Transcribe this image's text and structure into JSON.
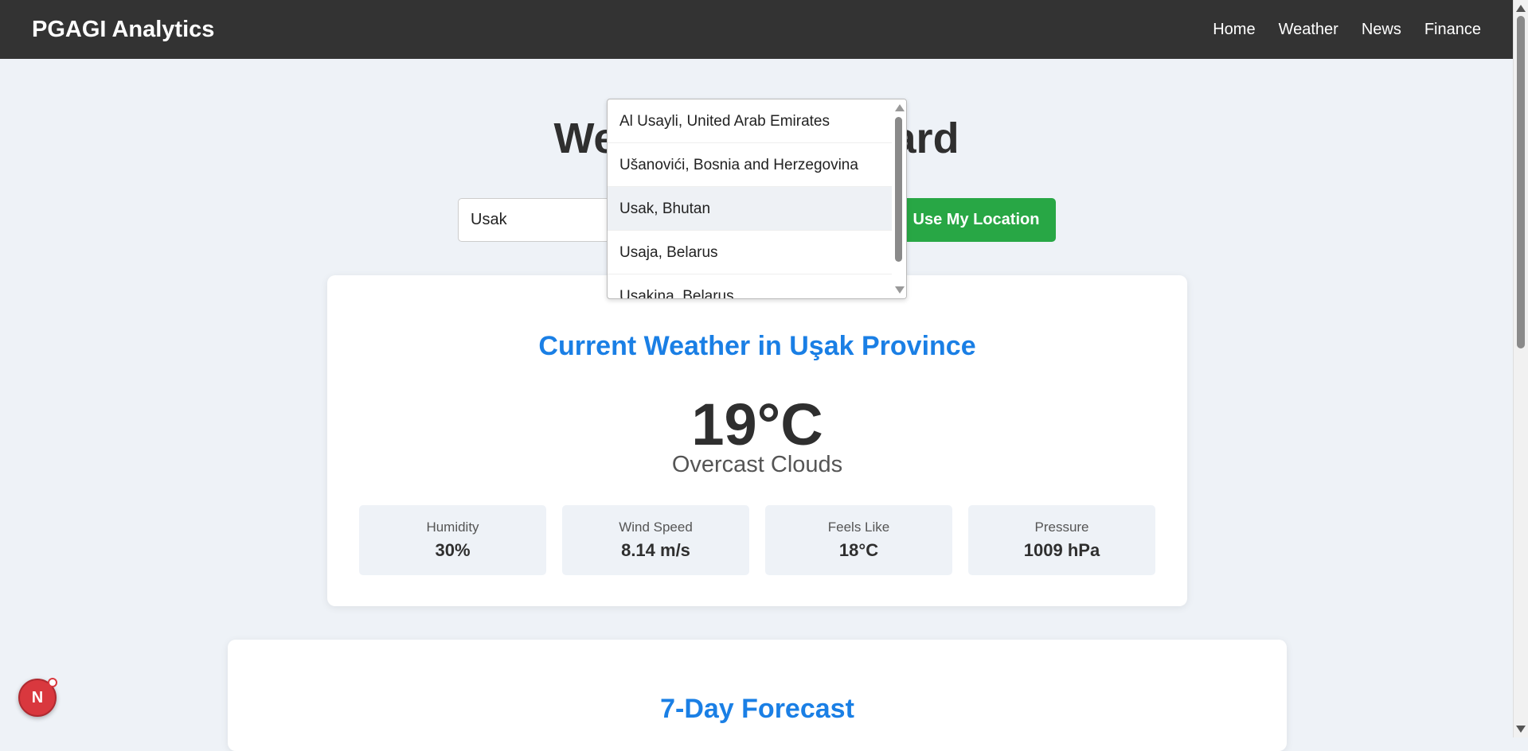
{
  "navbar": {
    "brand": "PGAGI Analytics",
    "links": [
      "Home",
      "Weather",
      "News",
      "Finance"
    ]
  },
  "page": {
    "heading": "Weather Dashboard"
  },
  "search": {
    "value": "Usak",
    "location_button": "Use My Location"
  },
  "dropdown": {
    "items": [
      "Al Usayli, United Arab Emirates",
      "Ušanovići, Bosnia and Herzegovina",
      "Usak, Bhutan",
      "Usaja, Belarus",
      "Usakina, Belarus"
    ],
    "highlighted_index": 2
  },
  "current_weather": {
    "title": "Current Weather in Uşak Province",
    "temperature": "19°C",
    "condition": "Overcast Clouds",
    "metrics": [
      {
        "label": "Humidity",
        "value": "30%"
      },
      {
        "label": "Wind Speed",
        "value": "8.14 m/s"
      },
      {
        "label": "Feels Like",
        "value": "18°C"
      },
      {
        "label": "Pressure",
        "value": "1009 hPa"
      }
    ]
  },
  "forecast": {
    "title": "7-Day Forecast"
  },
  "badge": {
    "letter": "N"
  },
  "colors": {
    "navbar_bg": "#333333",
    "accent_blue": "#1a7fe5",
    "button_green": "#28a745",
    "page_bg": "#eef2f7",
    "badge_red": "#d9383e"
  }
}
